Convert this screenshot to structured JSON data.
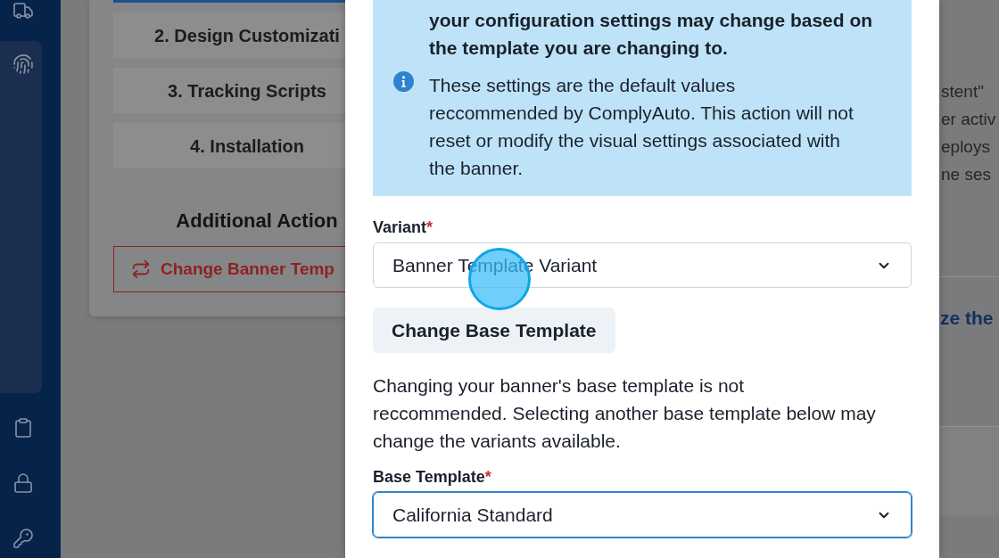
{
  "steps": [
    {
      "label": "2. Design Customizati",
      "selected": false
    },
    {
      "label": "3. Tracking Scripts",
      "selected": false
    },
    {
      "label": "4. Installation",
      "selected": false
    }
  ],
  "additional_actions": {
    "title": "Additional Action",
    "button": "Change Banner Temp"
  },
  "modal": {
    "alert": {
      "title": "your configuration settings may change based on the template you are changing to.",
      "message": "These settings are the default values reccommended by ComplyAuto. This action will not reset or modify the visual settings associated with the banner."
    },
    "variant": {
      "label": "Variant",
      "required_mark": "*",
      "value": "Banner Template Variant",
      "focused": false
    },
    "change_button": "Change Base Template",
    "note": "Changing your banner's base template is not reccommended. Selecting another base template below may change the variants available.",
    "base_template": {
      "label": "Base Template",
      "required_mark": "*",
      "value": "California Standard",
      "focused": true
    }
  },
  "right_column": {
    "lines": [
      "stent\"",
      "er activ",
      "eploys",
      "ne ses"
    ],
    "heading": "ze the"
  }
}
